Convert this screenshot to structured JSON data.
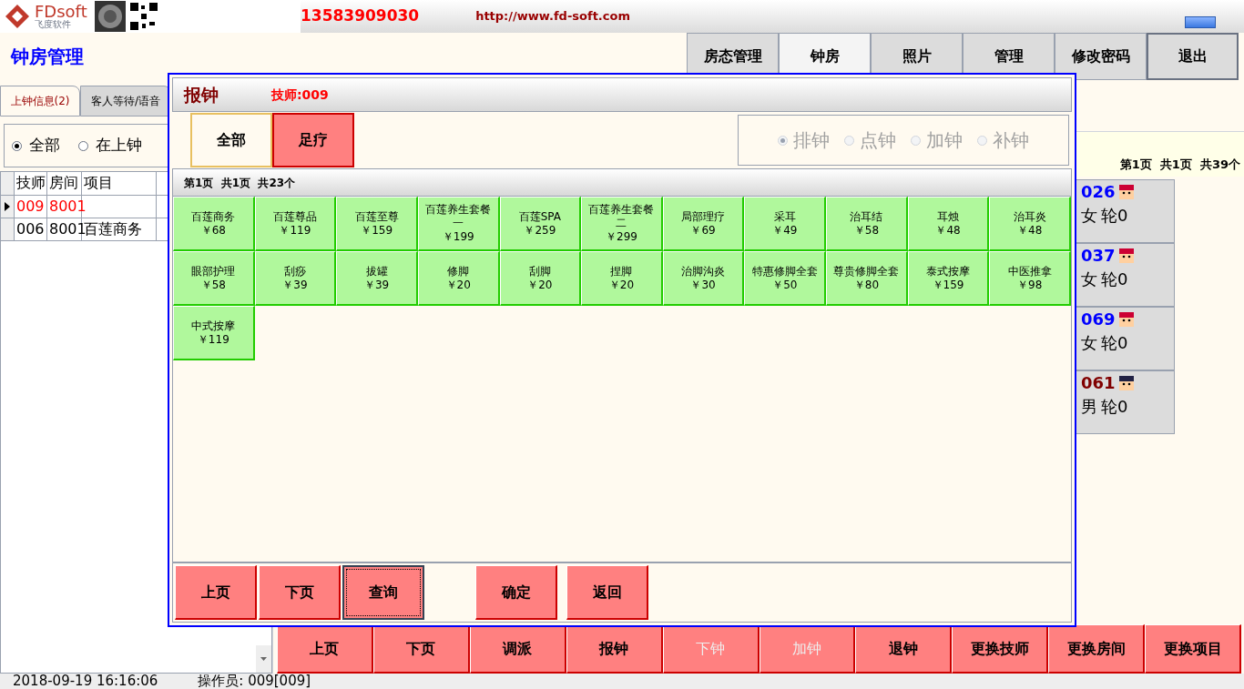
{
  "header": {
    "logo": "FDsoft",
    "logo_subtitle": "飞度软件",
    "phone": "13583909030",
    "url": "http://www.fd-soft.com"
  },
  "page_title": "钟房管理",
  "nav": [
    {
      "label": "房态管理",
      "selected": false
    },
    {
      "label": "钟房",
      "selected": true
    },
    {
      "label": "照片",
      "selected": false
    },
    {
      "label": "管理",
      "selected": false
    },
    {
      "label": "修改密码",
      "selected": false
    },
    {
      "label": "退出",
      "selected": false
    }
  ],
  "left_tabs": [
    {
      "label": "上钟信息(2)",
      "selected": true
    },
    {
      "label": "客人等待/语音",
      "selected": false
    }
  ],
  "filter": [
    {
      "label": "全部",
      "selected": true
    },
    {
      "label": "在上钟",
      "selected": false
    }
  ],
  "table": {
    "columns": [
      "技师",
      "房间",
      "项目"
    ],
    "rows": [
      {
        "selected": true,
        "cells": [
          "009",
          "8001",
          ""
        ]
      },
      {
        "selected": false,
        "cells": [
          "006",
          "8001",
          "百莲商务"
        ]
      }
    ]
  },
  "pager_info": "第1页  共1页  共39个",
  "technicians": [
    {
      "number": "026",
      "gender": "女",
      "turn": "轮0",
      "color": "#0000ff"
    },
    {
      "number": "037",
      "gender": "女",
      "turn": "轮0",
      "color": "#0000ff"
    },
    {
      "number": "069",
      "gender": "女",
      "turn": "轮0",
      "color": "#0000ff"
    },
    {
      "number": "061",
      "gender": "男",
      "turn": "轮0",
      "color": "#800000"
    }
  ],
  "bottom_buttons": [
    {
      "label": "上页",
      "disabled": false
    },
    {
      "label": "下页",
      "disabled": false
    },
    {
      "label": "调派",
      "disabled": false
    },
    {
      "label": "报钟",
      "disabled": false
    },
    {
      "label": "下钟",
      "disabled": true
    },
    {
      "label": "加钟",
      "disabled": true
    },
    {
      "label": "退钟",
      "disabled": false
    },
    {
      "label": "更换技师",
      "disabled": false
    },
    {
      "label": "更换房间",
      "disabled": false
    },
    {
      "label": "更换项目",
      "disabled": false
    }
  ],
  "status_bar": {
    "datetime": "2018-09-19 16:16:06",
    "operator": "操作员: 009[009]"
  },
  "dialog": {
    "title": "报钟",
    "technician": "技师:009",
    "categories": [
      {
        "label": "全部",
        "selected": false
      },
      {
        "label": "足疗",
        "selected": true
      }
    ],
    "modes": [
      {
        "label": "排钟",
        "selected": true
      },
      {
        "label": "点钟",
        "selected": false
      },
      {
        "label": "加钟",
        "selected": false
      },
      {
        "label": "补钟",
        "selected": false
      }
    ],
    "modes_disabled": true,
    "page_info": "第1页  共1页  共23个",
    "items": [
      {
        "name": "百莲商务",
        "price": "￥68"
      },
      {
        "name": "百莲尊品",
        "price": "￥119"
      },
      {
        "name": "百莲至尊",
        "price": "￥159"
      },
      {
        "name": "百莲养生套餐一",
        "price": "￥199"
      },
      {
        "name": "百莲SPA",
        "price": "￥259"
      },
      {
        "name": "百莲养生套餐二",
        "price": "￥299"
      },
      {
        "name": "局部理疗",
        "price": "￥69"
      },
      {
        "name": "采耳",
        "price": "￥49"
      },
      {
        "name": "治耳结",
        "price": "￥58"
      },
      {
        "name": "耳烛",
        "price": "￥48"
      },
      {
        "name": "治耳炎",
        "price": "￥48"
      },
      {
        "name": "眼部护理",
        "price": "￥58"
      },
      {
        "name": "刮痧",
        "price": "￥39"
      },
      {
        "name": "拔罐",
        "price": "￥39"
      },
      {
        "name": "修脚",
        "price": "￥20"
      },
      {
        "name": "刮脚",
        "price": "￥20"
      },
      {
        "name": "捏脚",
        "price": "￥20"
      },
      {
        "name": "治脚沟炎",
        "price": "￥30"
      },
      {
        "name": "特惠修脚全套",
        "price": "￥50"
      },
      {
        "name": "尊贵修脚全套",
        "price": "￥80"
      },
      {
        "name": "泰式按摩",
        "price": "￥159"
      },
      {
        "name": "中医推拿",
        "price": "￥98"
      },
      {
        "name": "中式按摩",
        "price": "￥119"
      }
    ],
    "buttons": [
      {
        "label": "上页",
        "focused": false
      },
      {
        "label": "下页",
        "focused": false
      },
      {
        "label": "查询",
        "focused": true
      },
      {
        "label": "确定",
        "focused": false
      },
      {
        "label": "返回",
        "focused": false
      }
    ]
  }
}
